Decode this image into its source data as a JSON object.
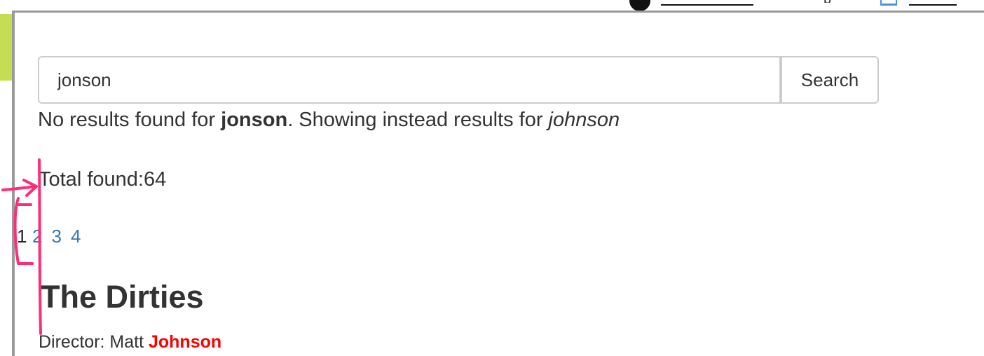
{
  "header": {
    "partial_text": "p"
  },
  "search": {
    "value": "jonson",
    "button_label": "Search"
  },
  "suggestion": {
    "prefix": "No results found for ",
    "query": "jonson",
    "middle": ". Showing instead results for ",
    "corrected": "johnson"
  },
  "results": {
    "total_label": "Total found:",
    "total_count": "64",
    "pagination": {
      "current": "1",
      "pages": [
        "2",
        "3",
        "4"
      ]
    },
    "items": [
      {
        "title": "The Dirties",
        "director_label": "Director: Matt ",
        "director_highlight": "Johnson"
      }
    ]
  },
  "colors": {
    "link": "#337ab7",
    "highlight": "#ff0000",
    "annotation": "#ff2d78",
    "side_tab": "#c5dd55"
  }
}
